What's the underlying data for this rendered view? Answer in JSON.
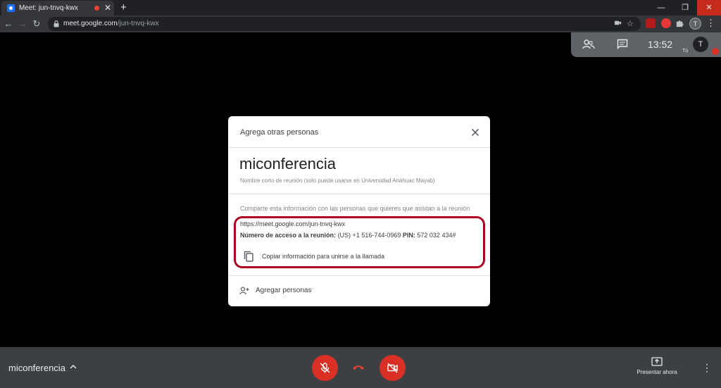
{
  "browser": {
    "tab_title": "Meet: jun-tnvq-kwx",
    "new_tab": "+",
    "url_host": "meet.google.com",
    "url_path": "/jun-tnvq-kwx",
    "profile_initial": "T",
    "window_buttons": {
      "minimize": "—",
      "restore": "❐",
      "close": "✕"
    }
  },
  "meet_top": {
    "time": "13:52",
    "self_initial": "T",
    "self_label": "Tú"
  },
  "dialog": {
    "title": "Agrega otras personas",
    "meeting_name": "miconferencia",
    "meeting_subtitle": "Nombre corto de reunión (solo puede usarse en Universidad Anáhuac Mayab)",
    "share_hint": "Comparte esta información con las personas que quieres que asistan a la reunión",
    "link": "https://meet.google.com/jun-tnvq-kwx",
    "access_label": "Número de acceso a la reunión:",
    "access_number": "(US) +1 516-744-0969",
    "pin_label": "PIN:",
    "pin_value": "572 032 434#",
    "copy_label": "Copiar información para unirse a la llamada",
    "add_people_label": "Agregar personas"
  },
  "bottom": {
    "meeting_name": "miconferencia",
    "present_label": "Presentar ahora"
  },
  "colors": {
    "accent_red": "#d93025",
    "highlight_border": "#b00020",
    "dialog_bg": "#ffffff",
    "bottom_bar": "#3c4043"
  }
}
